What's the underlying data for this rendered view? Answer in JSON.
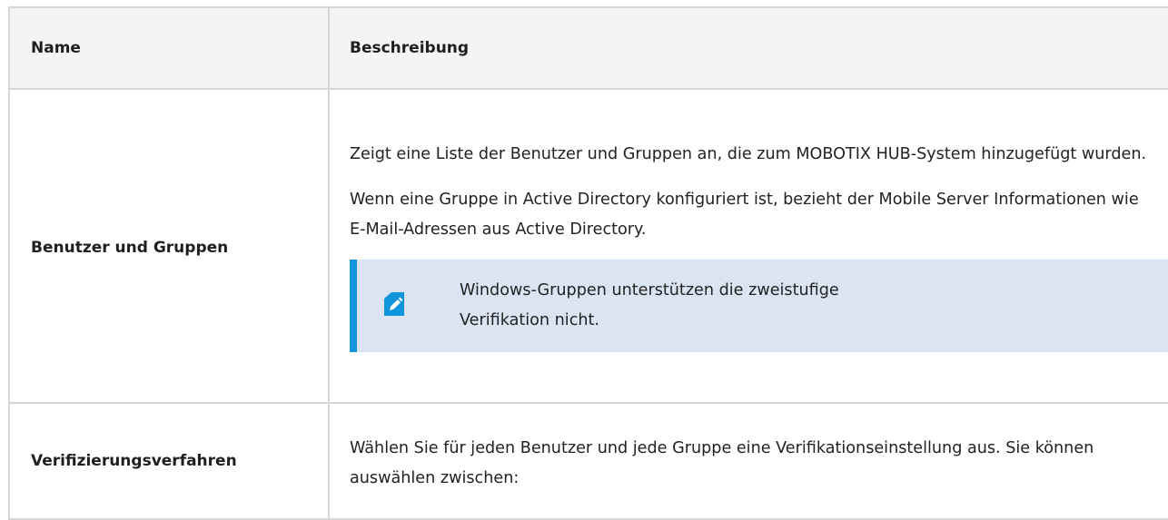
{
  "table": {
    "headers": {
      "name": "Name",
      "description": "Beschreibung"
    },
    "rows": [
      {
        "name": "Benutzer und Gruppen",
        "paragraph1": "Zeigt eine Liste der Benutzer und Gruppen an, die zum MOBOTIX HUB-System hinzugefügt wurden.",
        "paragraph2": "Wenn eine Gruppe in Active Directory konfiguriert ist, bezieht der Mobile Server Informationen wie E-Mail-Adressen aus Active Directory.",
        "note": {
          "icon": "pencil-note-icon",
          "text": "Windows-Gruppen unterstützen die zweistufige Verifikation nicht."
        }
      },
      {
        "name": "Verifizierungsverfahren",
        "paragraph1": "Wählen Sie für jeden Benutzer und jede Gruppe eine Verifikationseinstellung aus. Sie können auswählen zwischen:"
      }
    ]
  },
  "colors": {
    "header_bg": "#f4f4f4",
    "border": "#d6d6d6",
    "note_bg": "#dae4f2",
    "note_accent": "#0f95dc"
  }
}
